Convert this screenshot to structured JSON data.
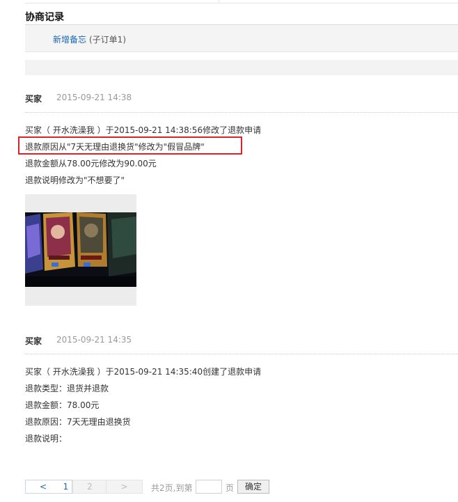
{
  "section": {
    "title": "协商记录",
    "add_memo": "新增备忘",
    "memo_note": "(子订单1)"
  },
  "records": [
    {
      "who": "买家",
      "time": "2015-09-21 14:38",
      "lines": [
        "买家（ 开水洗澡我 ）于2015-09-21 14:38:56修改了退款申请",
        "退款原因从\"7天无理由退换货\"修改为\"假冒品牌\"",
        "退款金额从78.00元修改为90.00元",
        "退款说明修改为\"不想要了\""
      ]
    },
    {
      "who": "买家",
      "time": "2015-09-21 14:35",
      "lines": [
        "买家（ 开水洗澡我 ）于2015-09-21 14:35:40创建了退款申请",
        "退款类型：退货并退款",
        "退款金额：78.00元",
        "退款原因：7天无理由退换货",
        "退款说明："
      ]
    }
  ],
  "pagination": {
    "prev": "<",
    "current": "1",
    "next_page": "2",
    "next": ">",
    "total_text": "共2页,到第",
    "page_word": "页",
    "page_input_value": "",
    "confirm": "确定"
  },
  "colors": {
    "link": "#1a66b3",
    "highlight": "#d9222a",
    "muted": "#999999"
  },
  "icons": {
    "attachment": "attachment-thumbnail"
  }
}
